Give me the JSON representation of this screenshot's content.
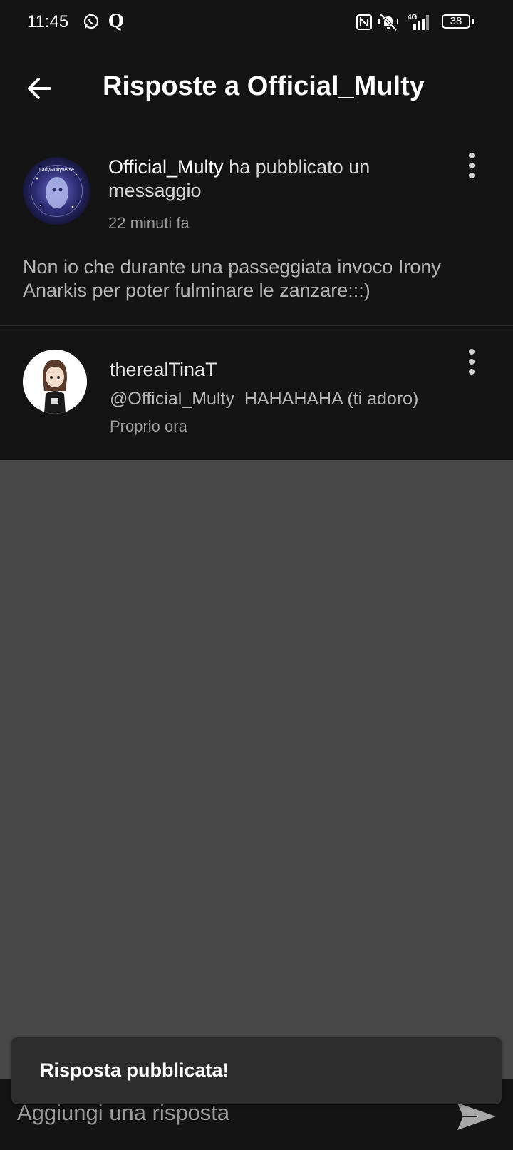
{
  "status_bar": {
    "time": "11:45",
    "battery": "38",
    "network": "4G",
    "icons": [
      "whatsapp-icon",
      "q-app-icon",
      "nfc-icon",
      "mute-vibrate-icon",
      "signal-icon",
      "battery-icon"
    ]
  },
  "header": {
    "title": "Risposte a Official_Multy",
    "back_icon": "arrow-left-icon"
  },
  "post": {
    "author": "Official_Multy",
    "action": " ha pubblicato un messaggio",
    "time": "22 minuti fa",
    "body": "Non io che durante una passeggiata invoco Irony Anarkis per poter fulminare le zanzare:::)",
    "avatar_text": "LadyMultyverse",
    "menu_icon": "more-vert-icon"
  },
  "reply": {
    "author": "therealTinaT",
    "text": "@Official_Multy  HAHAHAHA (ti adoro)",
    "time": "Proprio ora",
    "menu_icon": "more-vert-icon"
  },
  "toast": {
    "text": "Risposta pubblicata!"
  },
  "composer": {
    "placeholder": "Aggiungi una risposta",
    "send_icon": "send-icon"
  },
  "colors": {
    "background_dark": "#141414",
    "empty_area": "#484848",
    "toast": "#2d2d2d"
  }
}
